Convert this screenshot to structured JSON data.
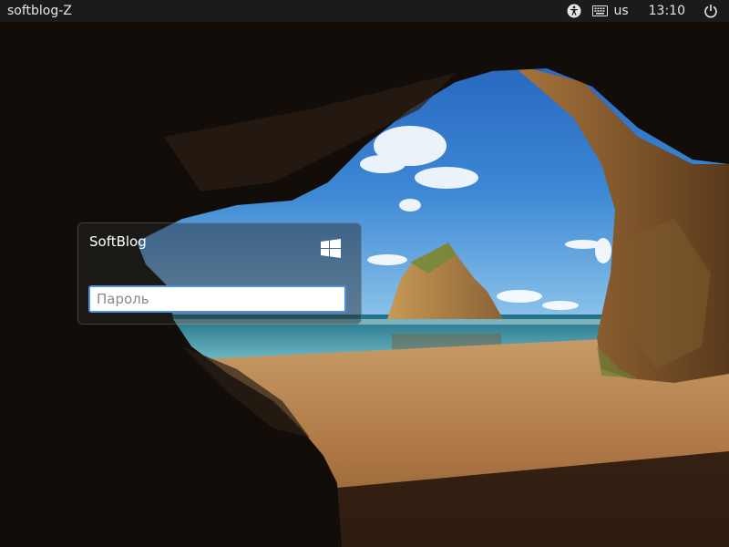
{
  "panel": {
    "hostname": "softblog-Z",
    "keyboard_layout": "us",
    "time": "13:10",
    "icons": [
      "accessibility-icon",
      "keyboard-icon",
      "power-icon"
    ]
  },
  "login": {
    "user_name": "SoftBlog",
    "password_placeholder": "Пароль",
    "password_value": "",
    "logo_icon": "windows-logo-icon"
  },
  "colors": {
    "panel_bg": "#1b1b1b",
    "input_focus_border": "#4f8ee0"
  }
}
